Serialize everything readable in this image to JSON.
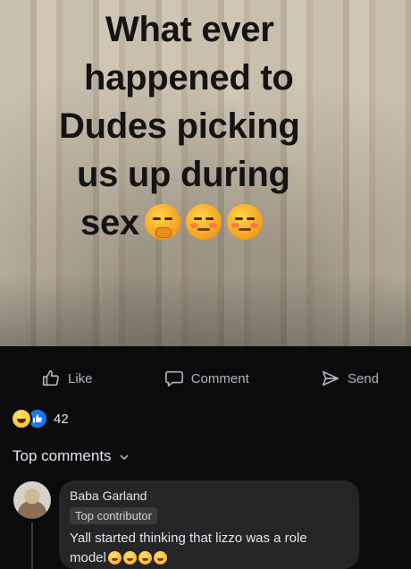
{
  "post": {
    "headline_lines": [
      "What ever",
      "happened to",
      "Dudes picking",
      "us up during",
      "sex"
    ],
    "headline_emojis": [
      "thinking-face-emoji",
      "relieved-face-emoji",
      "relieved-face-emoji"
    ]
  },
  "actions": {
    "like_label": "Like",
    "comment_label": "Comment",
    "send_label": "Send"
  },
  "reactions": {
    "icons": [
      "haha-reaction-icon",
      "like-reaction-icon"
    ],
    "count": "42"
  },
  "comments_header": {
    "label": "Top comments"
  },
  "comment": {
    "author": "Baba Garland",
    "badge": "Top contributor",
    "text_line1": "Yall started thinking that lizzo was a role",
    "text_line2": "model",
    "emojis": [
      "laughing-emoji",
      "laughing-emoji",
      "laughing-emoji",
      "laughing-emoji"
    ]
  },
  "colors": {
    "background": "#0b0b0d",
    "bubble": "#242526",
    "text": "#e4e6eb",
    "muted": "#b0b3b8",
    "like_blue": "#1877f2"
  }
}
